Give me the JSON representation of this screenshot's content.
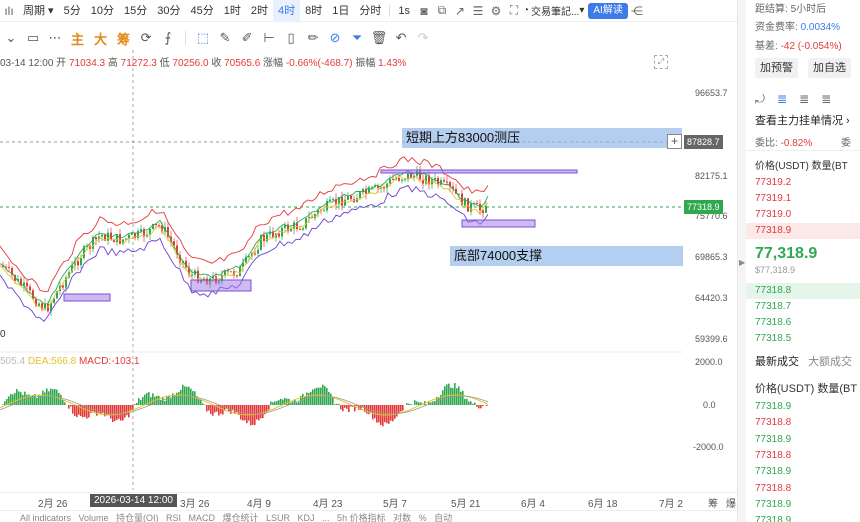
{
  "toolbar": {
    "period_label": "周期",
    "timeframes": [
      "5分",
      "10分",
      "15分",
      "30分",
      "45分",
      "1时",
      "2时",
      "4时",
      "8时",
      "1日",
      "分时"
    ],
    "active_timeframe": "4时",
    "interval_label": "1s",
    "journal_label": "交易筆記...",
    "ai_label": "AI解读"
  },
  "draw_toolbar": {
    "labels": [
      "主",
      "大",
      "筹"
    ]
  },
  "ohlc": {
    "date": "03-14 12:00",
    "open_label": "开",
    "open": "71034.3",
    "high_label": "高",
    "high": "71272.3",
    "low_label": "低",
    "low": "70256.0",
    "close_label": "收",
    "close": "70565.6",
    "change_label": "涨幅",
    "change": "-0.66%(-468.7)",
    "amplitude_label": "振幅",
    "amplitude": "1.43%"
  },
  "price_axis": {
    "ticks": [
      "96653.7",
      "82175.1",
      "75770.6",
      "69865.3",
      "64420.3",
      "59399.6"
    ],
    "current_price": "77318.9",
    "line_price": "87828.7"
  },
  "annotations": {
    "resistance": "短期上方83000测压",
    "support": "底部74000支撑"
  },
  "left_marker": "0",
  "macd": {
    "dif_label": "505.4",
    "dea_label": "DEA:566.8",
    "macd_label": "MACD:-103.1",
    "axis": [
      "2000.0",
      "0.0",
      "-2000.0"
    ]
  },
  "time_axis": {
    "labels": [
      "2月 26",
      "3月 26",
      "4月 9",
      "4月 23",
      "5月 7",
      "5月 21",
      "6月 4",
      "6月 18",
      "7月 2"
    ],
    "crosshair_time": "2026-03-14 12:00",
    "corner": [
      "筹",
      "爆"
    ]
  },
  "bottom_tabs": "All indicators   Volume   持仓量(OI)   RSI   MACD   爆仓统计   LSUR   KDJ   ...   5h 价格指标   对数   %   自动",
  "right_panel": {
    "settlement_label": "距结算:",
    "settlement_value": "5小时后",
    "funding_label": "资金费率:",
    "funding_value": "0.0034%",
    "basis_label": "基差:",
    "basis_value": "-42 (-0.054%)",
    "buttons": [
      "加预警",
      "加自选"
    ],
    "depth_link": "查看主力挂单情况",
    "ratio_label": "委比:",
    "ratio_value": "-0.82%",
    "ratio_right": "委",
    "header_price": "价格(USDT)",
    "header_qty": "数量(BT",
    "asks": [
      "77319.2",
      "77319.1",
      "77319.0",
      "77318.9"
    ],
    "last_price": "77,318.9",
    "mark_price": "$77,318.9",
    "bids": [
      "77318.8",
      "77318.7",
      "77318.6",
      "77318.5"
    ],
    "trades_tab": "最新成交",
    "big_trades_tab": "大额成交",
    "trades_header_price": "价格(USDT)",
    "trades_header_qty": "数量(BT",
    "trades": [
      {
        "p": "77318.9",
        "c": "grn"
      },
      {
        "p": "77318.8",
        "c": "red"
      },
      {
        "p": "77318.9",
        "c": "grn"
      },
      {
        "p": "77318.8",
        "c": "red"
      },
      {
        "p": "77318.9",
        "c": "grn"
      },
      {
        "p": "77318.8",
        "c": "red"
      },
      {
        "p": "77318.9",
        "c": "grn"
      },
      {
        "p": "77318.9",
        "c": "grn"
      }
    ]
  },
  "colors": {
    "up": "#2fa84f",
    "down": "#e43a3a",
    "accent": "#3c7be8"
  }
}
